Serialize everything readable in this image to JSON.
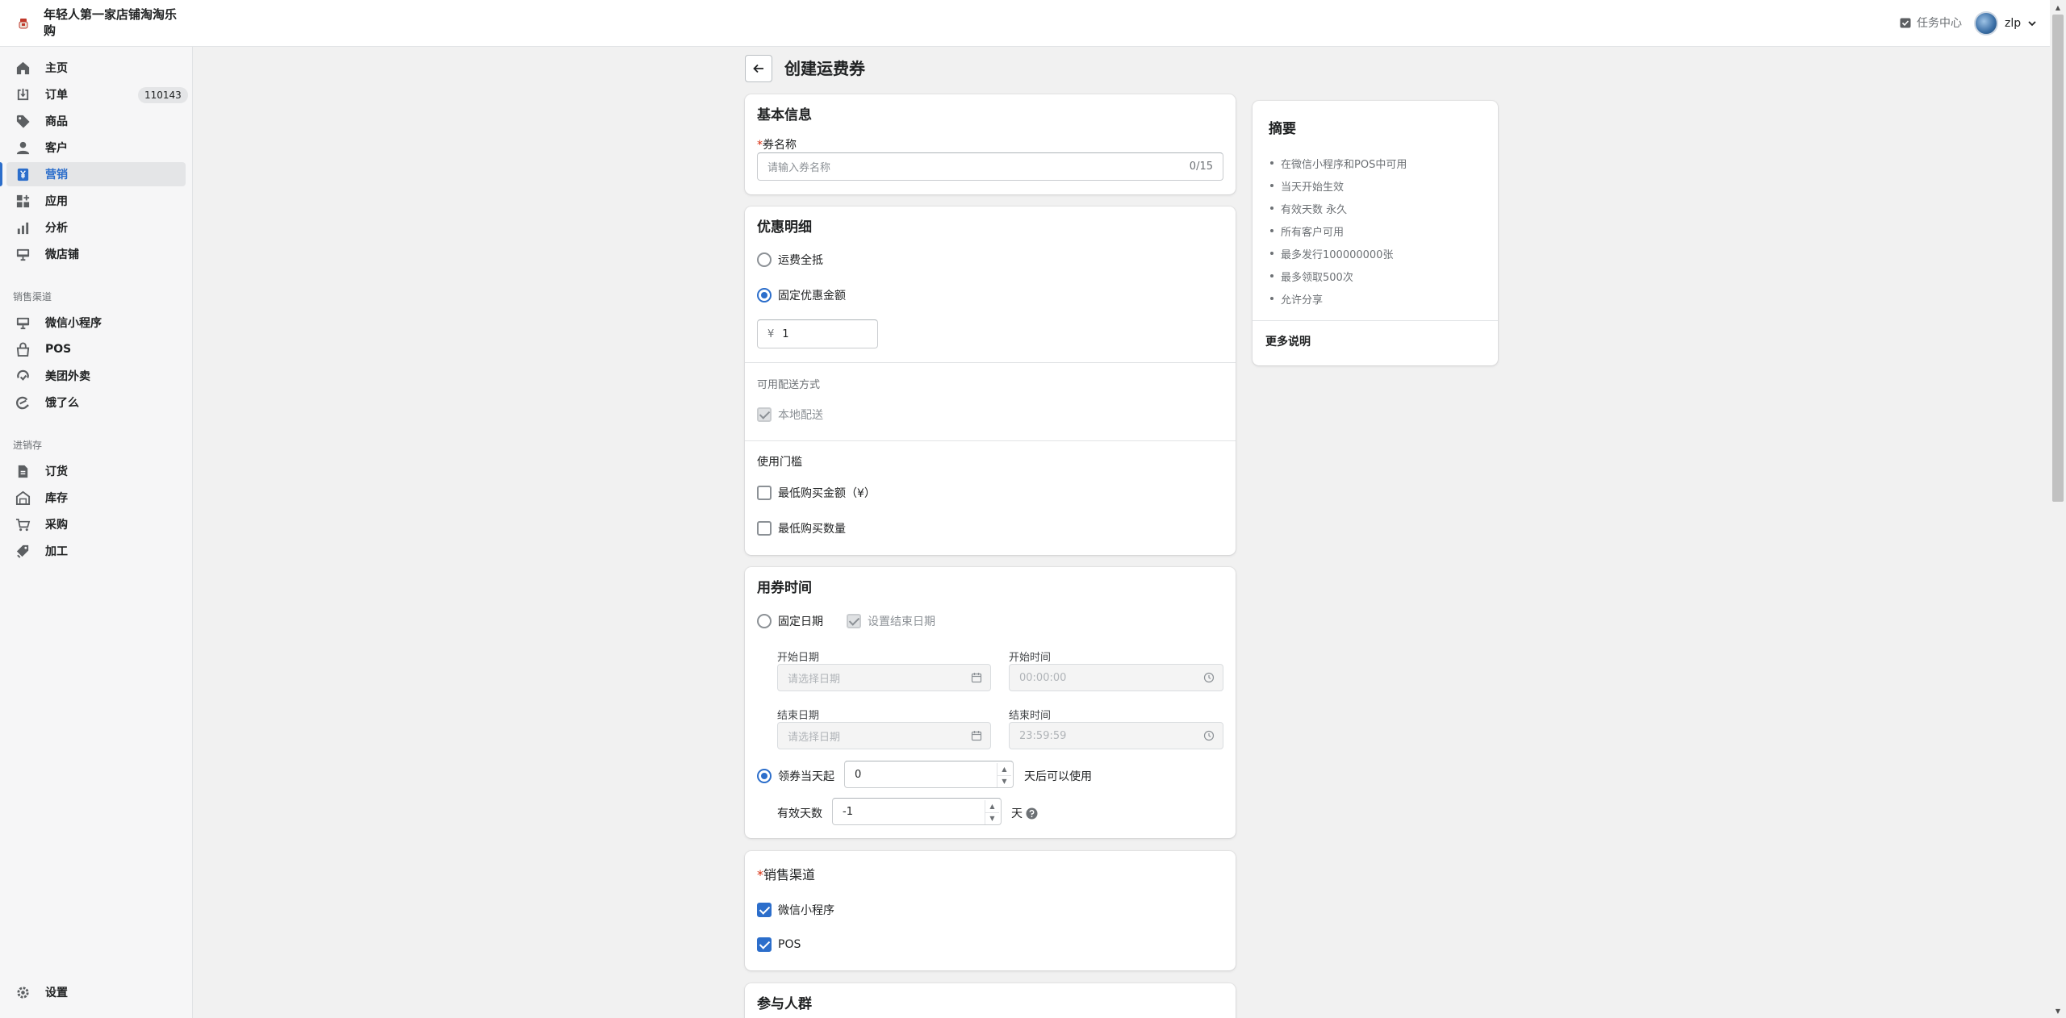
{
  "header": {
    "store_name": "年轻人第一家店铺淘淘乐购",
    "task_center": "任务中心",
    "user_name": "zlp"
  },
  "sidebar": {
    "main_items": [
      {
        "label": "主页",
        "icon": "home-icon"
      },
      {
        "label": "订单",
        "icon": "orders-icon",
        "badge": "110143"
      },
      {
        "label": "商品",
        "icon": "tag-icon"
      },
      {
        "label": "客户",
        "icon": "person-icon"
      },
      {
        "label": "营销",
        "icon": "marketing-icon",
        "active": true
      },
      {
        "label": "应用",
        "icon": "apps-icon"
      },
      {
        "label": "分析",
        "icon": "analytics-icon"
      },
      {
        "label": "微店铺",
        "icon": "storefront-icon"
      }
    ],
    "sales_channel_title": "销售渠道",
    "sales_channels": [
      {
        "label": "微信小程序",
        "icon": "mini-program-icon"
      },
      {
        "label": "POS",
        "icon": "pos-icon"
      },
      {
        "label": "美团外卖",
        "icon": "meituan-icon"
      },
      {
        "label": "饿了么",
        "icon": "eleme-icon"
      }
    ],
    "inventory_title": "进销存",
    "inventory_items": [
      {
        "label": "订货",
        "icon": "order-goods-icon"
      },
      {
        "label": "库存",
        "icon": "warehouse-icon"
      },
      {
        "label": "采购",
        "icon": "cart-icon"
      },
      {
        "label": "加工",
        "icon": "process-icon"
      }
    ],
    "settings": "设置"
  },
  "page": {
    "title": "创建运费券"
  },
  "basic_info": {
    "title": "基本信息",
    "name_label_req": "*",
    "name_label": "券名称",
    "name_placeholder": "请输入券名称",
    "name_count": "0/15"
  },
  "discount": {
    "title": "优惠明细",
    "option_full": "运费全抵",
    "option_fixed": "固定优惠金额",
    "currency": "¥",
    "amount": "1",
    "delivery_title": "可用配送方式",
    "delivery_local": "本地配送",
    "threshold_title": "使用门槛",
    "min_amount": "最低购买金额（¥）",
    "min_qty": "最低购买数量"
  },
  "validity": {
    "title": "用券时间",
    "fixed_date": "固定日期",
    "set_end_date": "设置结束日期",
    "start_date_label": "开始日期",
    "start_date_placeholder": "请选择日期",
    "start_time_label": "开始时间",
    "start_time": "00:00:00",
    "end_date_label": "结束日期",
    "end_date_placeholder": "请选择日期",
    "end_time_label": "结束时间",
    "end_time": "23:59:59",
    "from_receive": "领券当天起",
    "days_after_value": "0",
    "days_after_suffix": "天后可以使用",
    "valid_days_label": "有效天数",
    "valid_days_value": "-1",
    "valid_days_suffix": "天"
  },
  "channels": {
    "title_req": "*",
    "title": "销售渠道",
    "mini_program": "微信小程序",
    "pos": "POS"
  },
  "audience": {
    "title": "参与人群"
  },
  "summary": {
    "title": "摘要",
    "items": [
      "在微信小程序和POS中可用",
      "当天开始生效",
      "有效天数 永久",
      "所有客户可用",
      "最多发行100000000张",
      "最多领取500次",
      "允许分享"
    ],
    "more": "更多说明"
  },
  "colors": {
    "accent": "#2c6ecb",
    "sidebar_bg": "#f6f6f7",
    "page_bg": "#f1f1f1"
  }
}
